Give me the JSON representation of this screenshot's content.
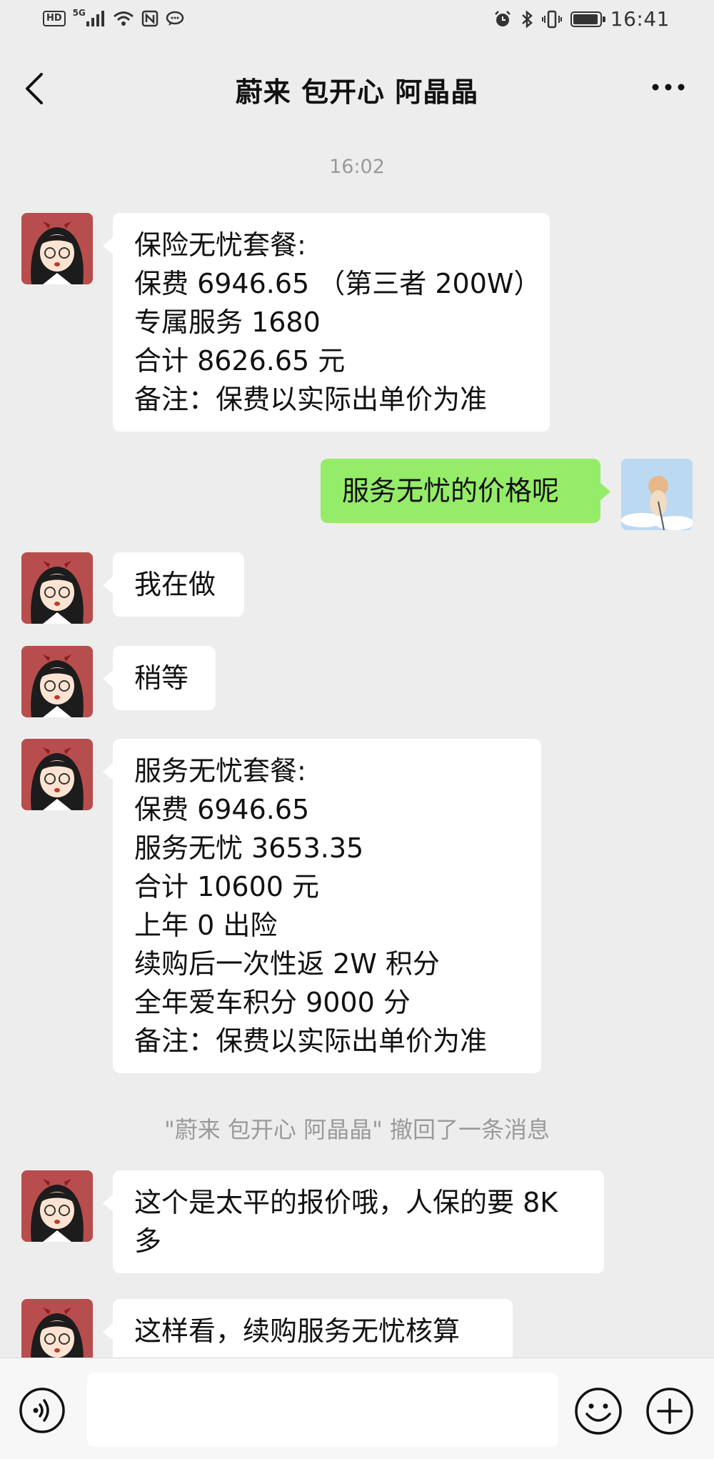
{
  "status_bar": {
    "hd": "HD",
    "network": "5G",
    "time": "16:41",
    "battery_level": 0.85,
    "icons": [
      "hd-icon",
      "signal-icon",
      "wifi-icon",
      "nfc-icon",
      "chat-bubble-icon",
      "alarm-icon",
      "bluetooth-icon",
      "vibrate-icon",
      "battery-icon"
    ]
  },
  "header": {
    "title": "蔚来 包开心 阿晶晶",
    "back_icon": "chevron-left-icon",
    "more_icon": "more-dots-icon"
  },
  "timestamp": "16:02",
  "messages": [
    {
      "side": "left",
      "lines": [
        "保险无忧套餐:",
        "保费 6946.65 （第三者 200W）",
        "专属服务 1680",
        "合计 8626.65 元",
        "备注：保费以实际出单价为准"
      ]
    },
    {
      "side": "right",
      "lines": [
        "服务无忧的价格呢"
      ]
    },
    {
      "side": "left",
      "lines": [
        "我在做"
      ]
    },
    {
      "side": "left",
      "lines": [
        "稍等"
      ]
    },
    {
      "side": "left",
      "lines": [
        "服务无忧套餐:",
        "保费 6946.65",
        "服务无忧 3653.35",
        "合计 10600 元",
        "上年 0 出险",
        "续购后一次性返 2W 积分",
        "全年爱车积分 9000 分",
        "备注：保费以实际出单价为准"
      ]
    },
    {
      "side": "left",
      "lines": [
        "这个是太平的报价哦，人保的要 8K",
        "多"
      ]
    },
    {
      "side": "left",
      "lines": [
        "这样看，续购服务无忧核算"
      ]
    }
  ],
  "recall_notice": "\"蔚来 包开心 阿晶晶\" 撤回了一条消息",
  "input_bar": {
    "voice_icon": "voice-icon",
    "emoji_icon": "emoji-icon",
    "plus_icon": "plus-icon",
    "value": ""
  },
  "colors": {
    "background": "#ededed",
    "bubble_self": "#95ec69",
    "bubble_other": "#ffffff",
    "meta_text": "#9a9a9a"
  }
}
